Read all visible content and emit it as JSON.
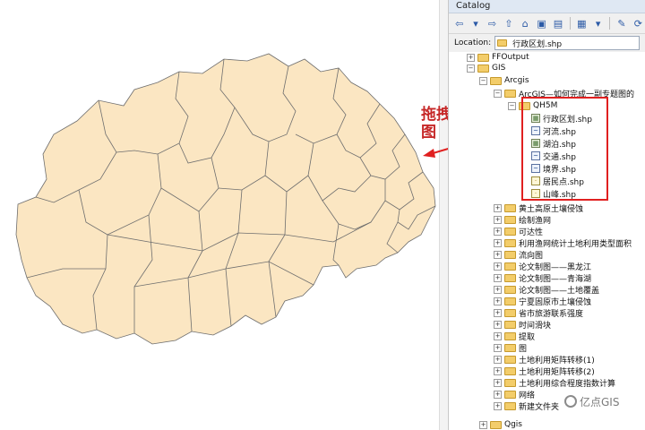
{
  "annotation": {
    "text": "拖拽至视图"
  },
  "catalog": {
    "title": "Catalog",
    "toolbar_icons": [
      "back-icon",
      "forward-icon",
      "up-folder-icon",
      "home-icon",
      "connect-folder-icon",
      "disconnect-icon",
      "views-icon",
      "options-icon"
    ],
    "location_label": "Location:",
    "location_value": "行政区划.shp",
    "tree": {
      "ffoutput": "FFOutput",
      "gis": "GIS",
      "arcgis": "Arcgis",
      "arcgis_sub": "ArcGIS—如何完成一副专题图的",
      "qh5m": "QH5M",
      "shapefiles": [
        {
          "label": "行政区划.shp",
          "kind": "polygon"
        },
        {
          "label": "河流.shp",
          "kind": "line"
        },
        {
          "label": "湖泊.shp",
          "kind": "polygon"
        },
        {
          "label": "交通.shp",
          "kind": "line"
        },
        {
          "label": "境界.shp",
          "kind": "line"
        },
        {
          "label": "居民点.shp",
          "kind": "point"
        },
        {
          "label": "山峰.shp",
          "kind": "point"
        }
      ],
      "folders": [
        "黄土高原土壤侵蚀",
        "绘制渔网",
        "可达性",
        "利用渔网统计土地利用类型面积",
        "流向图",
        "论文制图——黑龙江",
        "论文制图——青海湖",
        "论文制图——土地覆盖",
        "宁夏固原市土壤侵蚀",
        "省市旅游联系强度",
        "时间滑块",
        "提取",
        "图",
        "土地利用矩阵转移(1)",
        "土地利用矩阵转移(2)",
        "土地利用综合程度指数计算",
        "网络",
        "新建文件夹"
      ],
      "qgis": "Qgis"
    }
  },
  "watermark": "亿点GIS"
}
